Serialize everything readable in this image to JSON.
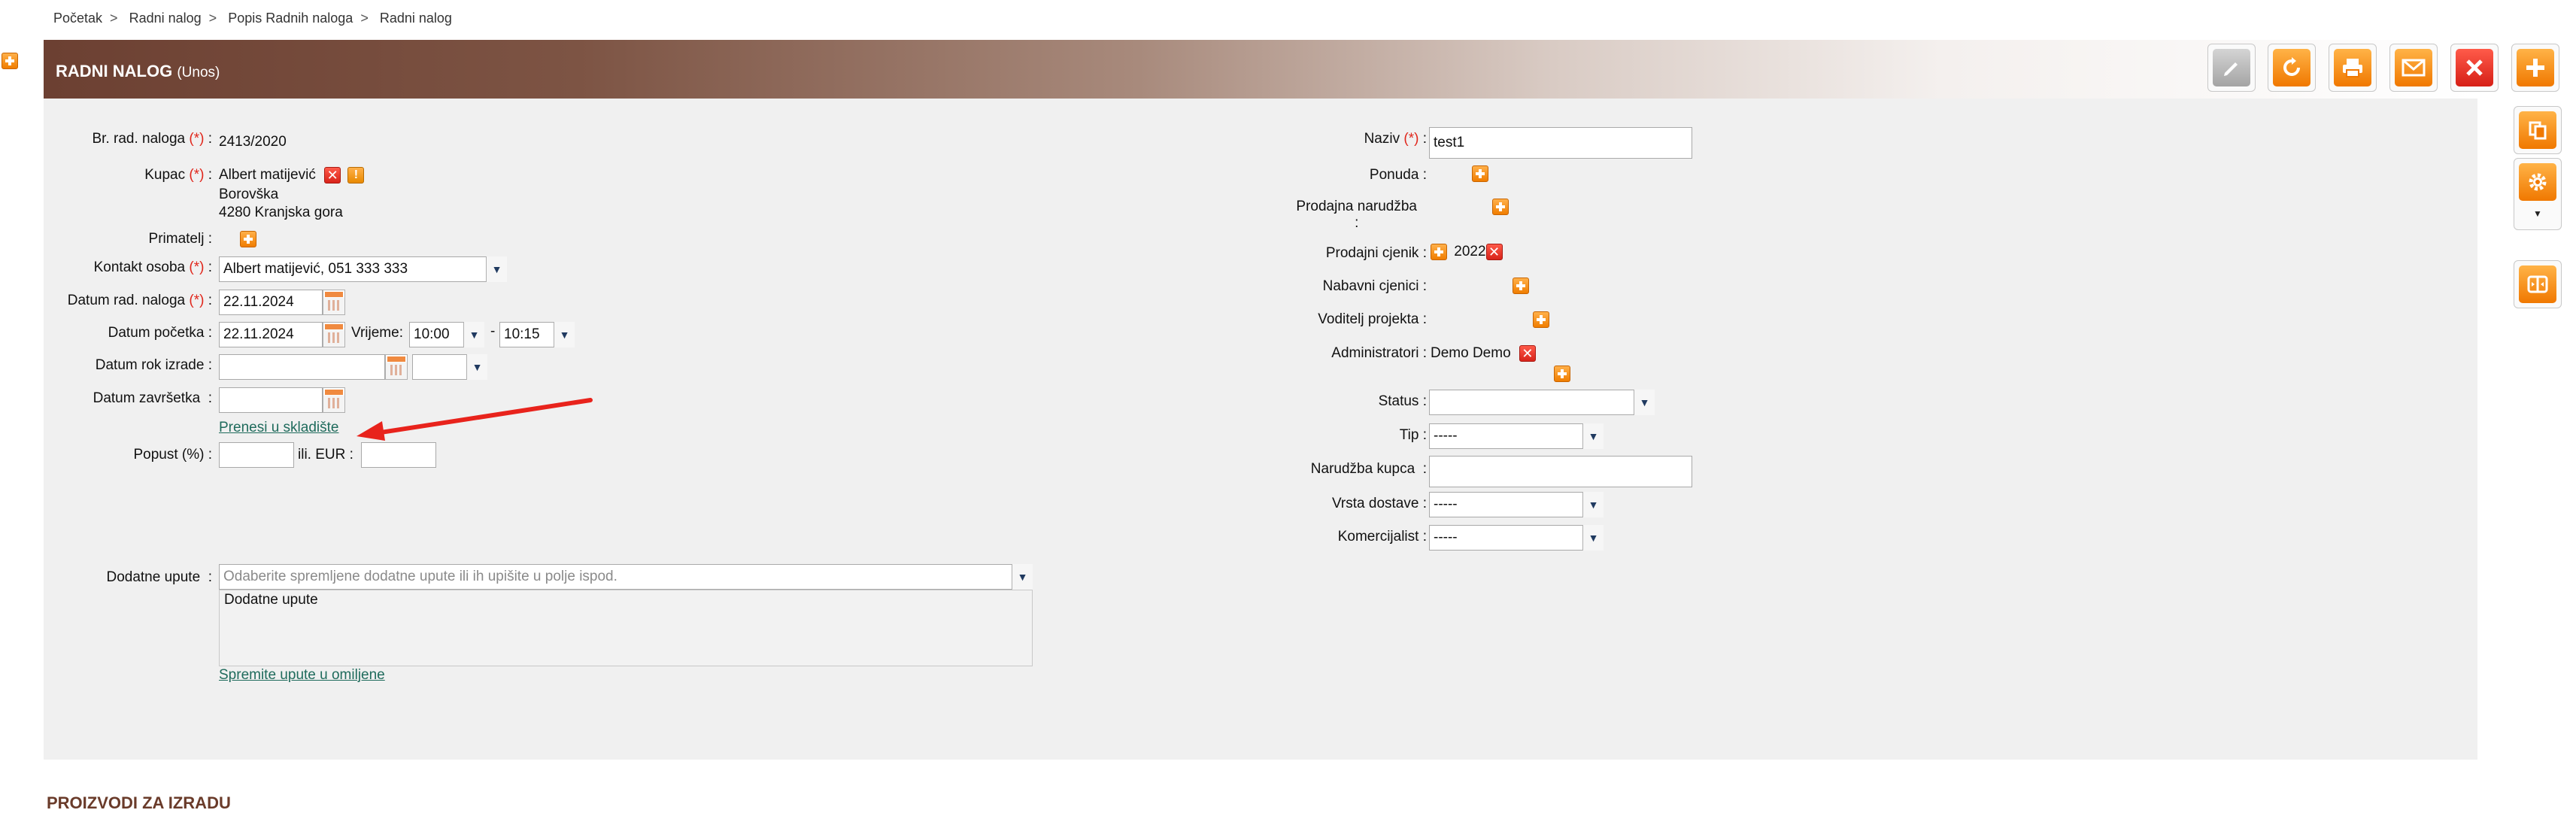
{
  "breadcrumb": [
    "Početak",
    "Radni nalog",
    "Popis Radnih naloga",
    "Radni nalog"
  ],
  "breadcrumb_separator": ">",
  "header": {
    "title": "RADNI NALOG",
    "subtitle": "(Unos)"
  },
  "toolbar_icons": [
    "edit-icon",
    "refresh-icon",
    "print-icon",
    "email-icon",
    "close-icon",
    "add-icon"
  ],
  "side_icons": [
    "copy-icon",
    "gear-icon",
    "chevron-down-icon",
    "split-icon"
  ],
  "left": {
    "br_rad_naloga": {
      "label": "Br. rad. naloga",
      "required": "(*)",
      "value": "2413/2020"
    },
    "kupac": {
      "label": "Kupac",
      "required": "(*)",
      "name": "Albert matijević",
      "street": "Borovška",
      "city": "4280 Kranjska gora"
    },
    "primatelj": {
      "label": "Primatelj"
    },
    "kontakt": {
      "label": "Kontakt osoba",
      "required": "(*)",
      "value": "Albert matijević, 051 333 333"
    },
    "datum_rad_naloga": {
      "label": "Datum rad. naloga",
      "required": "(*)",
      "value": "22.11.2024"
    },
    "datum_pocetka": {
      "label": "Datum početka",
      "value": "22.11.2024",
      "vrijeme_label": "Vrijeme:",
      "from": "10:00",
      "dash": "-",
      "to": "10:15"
    },
    "datum_rok": {
      "label": "Datum rok izrade",
      "value": "",
      "time": ""
    },
    "datum_zavrsetka": {
      "label": "Datum završetka",
      "value": ""
    },
    "prenesi_link": "Prenesi u skladište",
    "popust": {
      "label": "Popust (%)",
      "ili": "ili. EUR :",
      "percent": "",
      "eur": ""
    },
    "dodatne": {
      "label": "Dodatne upute",
      "placeholder": "Odaberite spremljene dodatne upute ili ih upišite u polje ispod.",
      "text": "Dodatne upute",
      "save_link": "Spremite upute u omiljene"
    }
  },
  "right": {
    "naziv": {
      "label": "Naziv",
      "required": "(*)",
      "value": "test1"
    },
    "ponuda": {
      "label": "Ponuda"
    },
    "prodajna_narudzba": {
      "label": "Prodajna narudžba",
      "colon": ":"
    },
    "prodajni_cjenik": {
      "label": "Prodajni cjenik",
      "value": "2022"
    },
    "nabavni_cjenici": {
      "label": "Nabavni cjenici"
    },
    "voditelj": {
      "label": "Voditelj projekta"
    },
    "administratori": {
      "label": "Administratori",
      "value": "Demo Demo"
    },
    "status": {
      "label": "Status",
      "value": ""
    },
    "tip": {
      "label": "Tip",
      "value": "-----"
    },
    "narudzba_kupca": {
      "label": "Narudžba kupca",
      "value": ""
    },
    "vrsta_dostave": {
      "label": "Vrsta dostave",
      "value": "-----"
    },
    "komercijalist": {
      "label": "Komercijalist",
      "value": "-----"
    }
  },
  "section_title": "PROIZVODI ZA IZRADU",
  "colors": {
    "header_dark": "#6c4032",
    "accent_orange": "#f07800",
    "required": "#e0261b",
    "link": "#1f6b5c",
    "annotation_arrow": "#e8231c"
  }
}
